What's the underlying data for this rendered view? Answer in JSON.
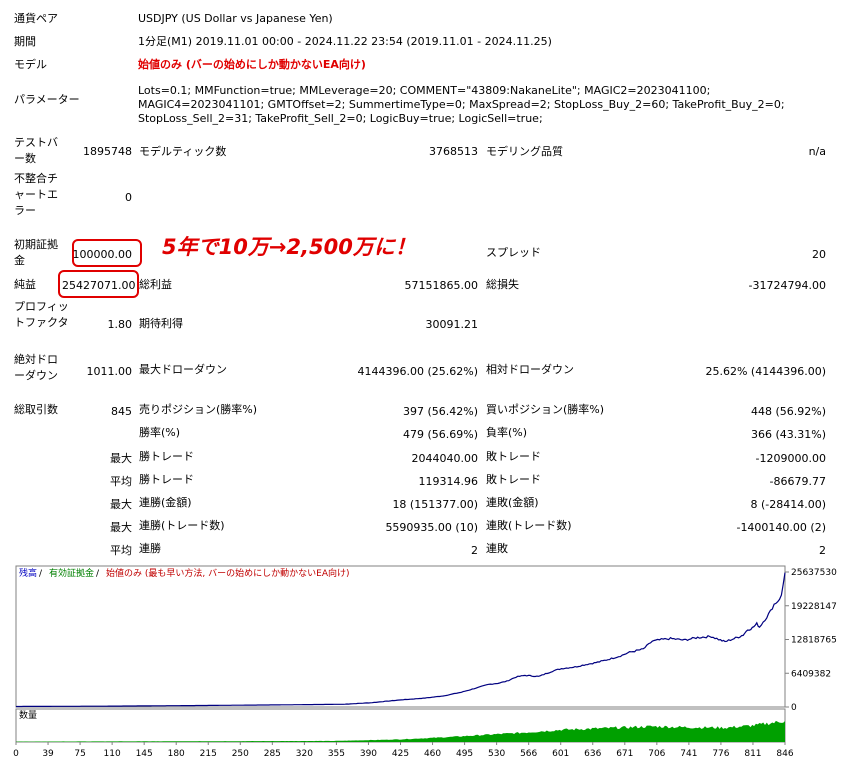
{
  "info": {
    "symbol": {
      "label": "通貨ペア",
      "value": "USDJPY (US Dollar vs Japanese Yen)"
    },
    "period": {
      "label": "期間",
      "value": "1分足(M1) 2019.11.01 00:00 - 2024.11.22 23:54 (2019.11.01 - 2024.11.25)"
    },
    "model": {
      "label": "モデル",
      "value": "始値のみ (バーの始めにしか動かないEA向け)"
    },
    "params": {
      "label": "パラメーター",
      "value": "Lots=0.1; MMFunction=true; MMLeverage=20; COMMENT=\"43809:NakaneLite\"; MAGIC2=2023041100; MAGIC4=2023041101; GMTOffset=2; SummertimeType=0; MaxSpread=2; StopLoss_Buy_2=60; TakeProfit_Buy_2=0; StopLoss_Sell_2=31; TakeProfit_Sell_2=0; LogicBuy=true; LogicSell=true;"
    }
  },
  "stats": {
    "bars": {
      "label": "テストバー数",
      "value": "1895748"
    },
    "ticks": {
      "label": "モデルティック数",
      "value": "3768513"
    },
    "quality": {
      "label": "モデリング品質",
      "value": "n/a"
    },
    "mismatch": {
      "label": "不整合チャートエラー",
      "value": "0"
    },
    "deposit": {
      "label": "初期証拠金",
      "value": "100000.00"
    },
    "spread": {
      "label": "スプレッド",
      "value": "20"
    },
    "net": {
      "label": "純益",
      "value": "25427071.00"
    },
    "gross_profit": {
      "label": "総利益",
      "value": "57151865.00"
    },
    "gross_loss": {
      "label": "総損失",
      "value": "-31724794.00"
    },
    "pf": {
      "label": "プロフィットファクタ",
      "value": "1.80"
    },
    "expected": {
      "label": "期待利得",
      "value": "30091.21"
    },
    "abs_dd": {
      "label": "絶対ドローダウン",
      "value": "1011.00"
    },
    "max_dd": {
      "label": "最大ドローダウン",
      "value": "4144396.00 (25.62%)"
    },
    "rel_dd": {
      "label": "相対ドローダウン",
      "value": "25.62% (4144396.00)"
    },
    "total_trades": {
      "label": "総取引数",
      "value": "845"
    },
    "short": {
      "label": "売りポジション(勝率%)",
      "value": "397 (56.42%)"
    },
    "long": {
      "label": "買いポジション(勝率%)",
      "value": "448 (56.92%)"
    },
    "win_rate": {
      "label": "勝率(%)",
      "value": "479 (56.69%)"
    },
    "loss_rate": {
      "label": "負率(%)",
      "value": "366 (43.31%)"
    }
  },
  "detail_rows": [
    {
      "prefix": "最大",
      "l_label": "勝トレード",
      "l_value": "2044040.00",
      "r_label": "敗トレード",
      "r_value": "-1209000.00"
    },
    {
      "prefix": "平均",
      "l_label": "勝トレード",
      "l_value": "119314.96",
      "r_label": "敗トレード",
      "r_value": "-86679.77"
    },
    {
      "prefix": "最大",
      "l_label": "連勝(金額)",
      "l_value": "18 (151377.00)",
      "r_label": "連敗(金額)",
      "r_value": "8 (-28414.00)"
    },
    {
      "prefix": "最大",
      "l_label": "連勝(トレード数)",
      "l_value": "5590935.00 (10)",
      "r_label": "連敗(トレード数)",
      "r_value": "-1400140.00 (2)"
    },
    {
      "prefix": "平均",
      "l_label": "連勝",
      "l_value": "2",
      "r_label": "連敗",
      "r_value": "2"
    }
  ],
  "annotation": "5年で10万→2,500万に！",
  "colors": {
    "balance": "#000080",
    "volume": "#00a000",
    "legend_balance": "#0000c0",
    "legend_equity": "#008000",
    "legend_model": "#c00000",
    "highlight": "#e00000"
  },
  "chart_data": {
    "type": "line",
    "legend": [
      {
        "name": "残高",
        "color": "#0000c0"
      },
      {
        "name": "有効証拠金",
        "color": "#008000"
      },
      {
        "name": "始値のみ (最も早い方法, バーの始めにしか動かないEA向け)",
        "color": "#c00000"
      }
    ],
    "y_ticks": [
      "25637530",
      "19228147",
      "12818765",
      "6409382",
      "0"
    ],
    "ylim": [
      0,
      25637530
    ],
    "xlim": [
      0,
      846
    ],
    "x_ticks": [
      "0",
      "39",
      "75",
      "110",
      "145",
      "180",
      "215",
      "250",
      "285",
      "320",
      "355",
      "390",
      "425",
      "460",
      "495",
      "530",
      "566",
      "601",
      "636",
      "671",
      "706",
      "741",
      "776",
      "811",
      "846"
    ],
    "volume_label": "数量",
    "series": [
      {
        "type": "line",
        "points": [
          [
            0,
            100000
          ],
          [
            100,
            160000
          ],
          [
            200,
            280000
          ],
          [
            300,
            420000
          ],
          [
            360,
            520000
          ],
          [
            390,
            800000
          ],
          [
            420,
            1300000
          ],
          [
            450,
            1700000
          ],
          [
            470,
            2100000
          ],
          [
            490,
            2800000
          ],
          [
            500,
            3300000
          ],
          [
            510,
            3800000
          ],
          [
            520,
            4300000
          ],
          [
            530,
            4500000
          ],
          [
            540,
            4900000
          ],
          [
            550,
            5700000
          ],
          [
            560,
            6000000
          ],
          [
            575,
            5800000
          ],
          [
            590,
            6800000
          ],
          [
            600,
            7300000
          ],
          [
            615,
            7600000
          ],
          [
            625,
            8000000
          ],
          [
            640,
            8500000
          ],
          [
            655,
            9200000
          ],
          [
            665,
            9700000
          ],
          [
            675,
            10400000
          ],
          [
            690,
            11000000
          ],
          [
            700,
            12500000
          ],
          [
            710,
            12800000
          ],
          [
            720,
            13000000
          ],
          [
            735,
            12700000
          ],
          [
            750,
            13200000
          ],
          [
            765,
            13400000
          ],
          [
            775,
            12700000
          ],
          [
            780,
            12400000
          ],
          [
            790,
            13000000
          ],
          [
            795,
            13300000
          ],
          [
            800,
            13700000
          ],
          [
            805,
            14700000
          ],
          [
            810,
            15000000
          ],
          [
            815,
            15800000
          ],
          [
            818,
            15200000
          ],
          [
            822,
            16200000
          ],
          [
            826,
            17100000
          ],
          [
            830,
            18200000
          ],
          [
            834,
            19500000
          ],
          [
            838,
            20100000
          ],
          [
            842,
            21100000
          ],
          [
            846,
            25527071
          ]
        ]
      },
      {
        "type": "volume",
        "points": [
          [
            0,
            0.02
          ],
          [
            350,
            0.05
          ],
          [
            420,
            0.12
          ],
          [
            470,
            0.22
          ],
          [
            520,
            0.35
          ],
          [
            560,
            0.45
          ],
          [
            600,
            0.58
          ],
          [
            650,
            0.66
          ],
          [
            700,
            0.74
          ],
          [
            740,
            0.7
          ],
          [
            780,
            0.68
          ],
          [
            810,
            0.78
          ],
          [
            846,
            1.0
          ]
        ]
      }
    ]
  }
}
